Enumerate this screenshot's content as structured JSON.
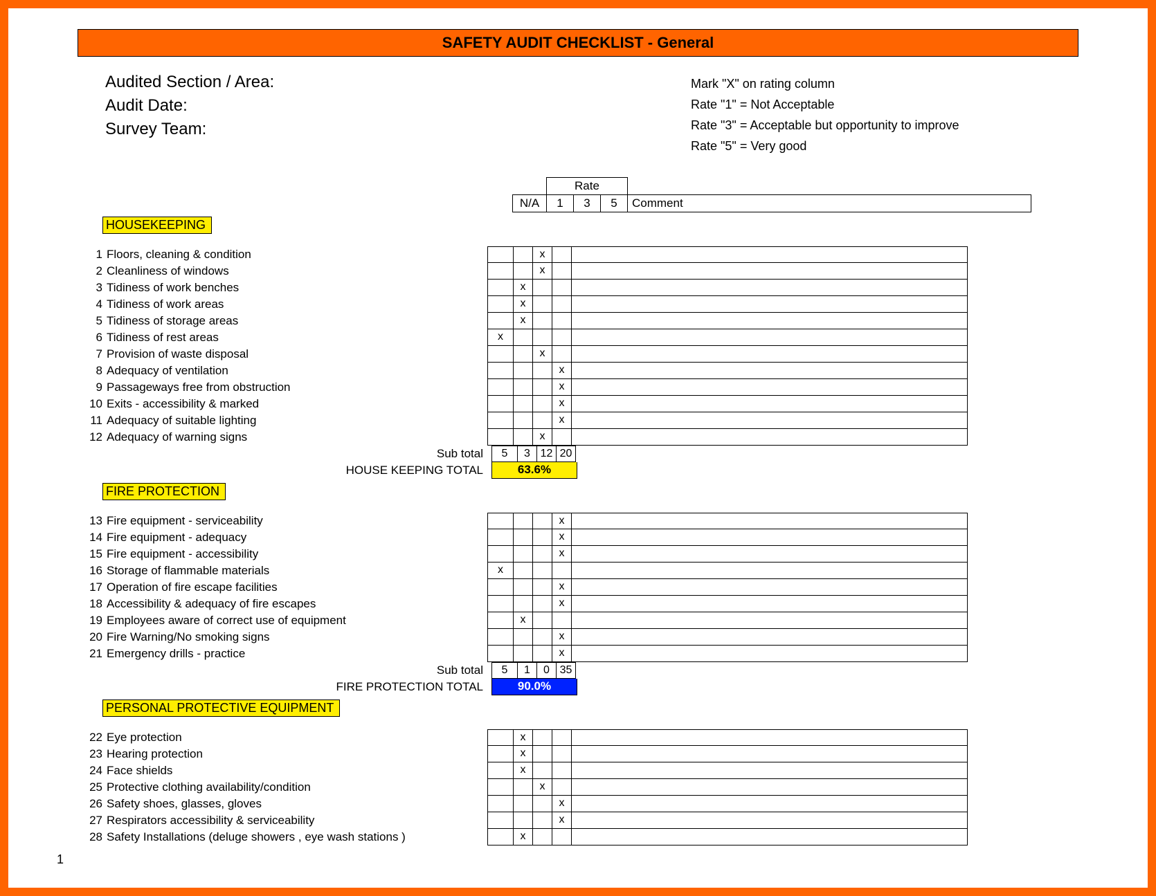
{
  "title": "SAFETY AUDIT CHECKLIST - General",
  "header_left": {
    "line1": "Audited Section / Area:",
    "line2": "Audit Date:",
    "line3": "Survey Team:"
  },
  "header_right": {
    "line1": "Mark \"X\" on rating column",
    "line2": "Rate \"1\" = Not Acceptable",
    "line3": "Rate \"3\" = Acceptable but opportunity to improve",
    "line4": "Rate \"5\" = Very good"
  },
  "rate_header": {
    "rate_label": "Rate",
    "na": "N/A",
    "r1": "1",
    "r3": "3",
    "r5": "5",
    "comment": "Comment"
  },
  "sections": [
    {
      "name": "HOUSEKEEPING",
      "items": [
        {
          "n": 1,
          "text": "Floors, cleaning & condition",
          "mark": "3"
        },
        {
          "n": 2,
          "text": "Cleanliness of windows",
          "mark": "3"
        },
        {
          "n": 3,
          "text": "Tidiness of work benches",
          "mark": "1"
        },
        {
          "n": 4,
          "text": "Tidiness of work areas",
          "mark": "1"
        },
        {
          "n": 5,
          "text": "Tidiness of storage areas",
          "mark": "1"
        },
        {
          "n": 6,
          "text": "Tidiness of rest areas",
          "mark": "na"
        },
        {
          "n": 7,
          "text": "Provision of waste disposal",
          "mark": "3"
        },
        {
          "n": 8,
          "text": "Adequacy of ventilation",
          "mark": "5"
        },
        {
          "n": 9,
          "text": "Passageways free from obstruction",
          "mark": "5"
        },
        {
          "n": 10,
          "text": "Exits - accessibility & marked",
          "mark": "5"
        },
        {
          "n": 11,
          "text": "Adequacy of suitable lighting",
          "mark": "5"
        },
        {
          "n": 12,
          "text": "Adequacy of warning signs",
          "mark": "3"
        }
      ],
      "subtotal_label": "Sub total",
      "subtotal": {
        "na": "5",
        "r1": "3",
        "r3": "12",
        "r5": "20"
      },
      "total_label": "HOUSE KEEPING TOTAL",
      "total_value": "63.6%",
      "total_class": "total-yellow"
    },
    {
      "name": "FIRE PROTECTION",
      "items": [
        {
          "n": 13,
          "text": "Fire equipment - serviceability",
          "mark": "5"
        },
        {
          "n": 14,
          "text": "Fire equipment - adequacy",
          "mark": "5"
        },
        {
          "n": 15,
          "text": "Fire equipment - accessibility",
          "mark": "5"
        },
        {
          "n": 16,
          "text": "Storage of flammable materials",
          "mark": "na"
        },
        {
          "n": 17,
          "text": "Operation of fire escape facilities",
          "mark": "5"
        },
        {
          "n": 18,
          "text": "Accessibility & adequacy of fire escapes",
          "mark": "5"
        },
        {
          "n": 19,
          "text": "Employees aware of correct use of equipment",
          "mark": "1"
        },
        {
          "n": 20,
          "text": "Fire Warning/No smoking signs",
          "mark": "5"
        },
        {
          "n": 21,
          "text": "Emergency drills - practice",
          "mark": "5"
        }
      ],
      "subtotal_label": "Sub total",
      "subtotal": {
        "na": "5",
        "r1": "1",
        "r3": "0",
        "r5": "35"
      },
      "total_label": "FIRE PROTECTION TOTAL",
      "total_value": "90.0%",
      "total_class": "total-blue"
    },
    {
      "name": "PERSONAL PROTECTIVE EQUIPMENT",
      "items": [
        {
          "n": 22,
          "text": "Eye protection",
          "mark": "1"
        },
        {
          "n": 23,
          "text": "Hearing protection",
          "mark": "1"
        },
        {
          "n": 24,
          "text": "Face shields",
          "mark": "1"
        },
        {
          "n": 25,
          "text": "Protective clothing availability/condition",
          "mark": "3"
        },
        {
          "n": 26,
          "text": "Safety shoes, glasses, gloves",
          "mark": "5"
        },
        {
          "n": 27,
          "text": "Respirators accessibility & serviceability",
          "mark": "5"
        },
        {
          "n": 28,
          "text": "Safety Installations (deluge showers , eye wash stations )",
          "mark": "1"
        }
      ]
    }
  ],
  "page_number": "1"
}
